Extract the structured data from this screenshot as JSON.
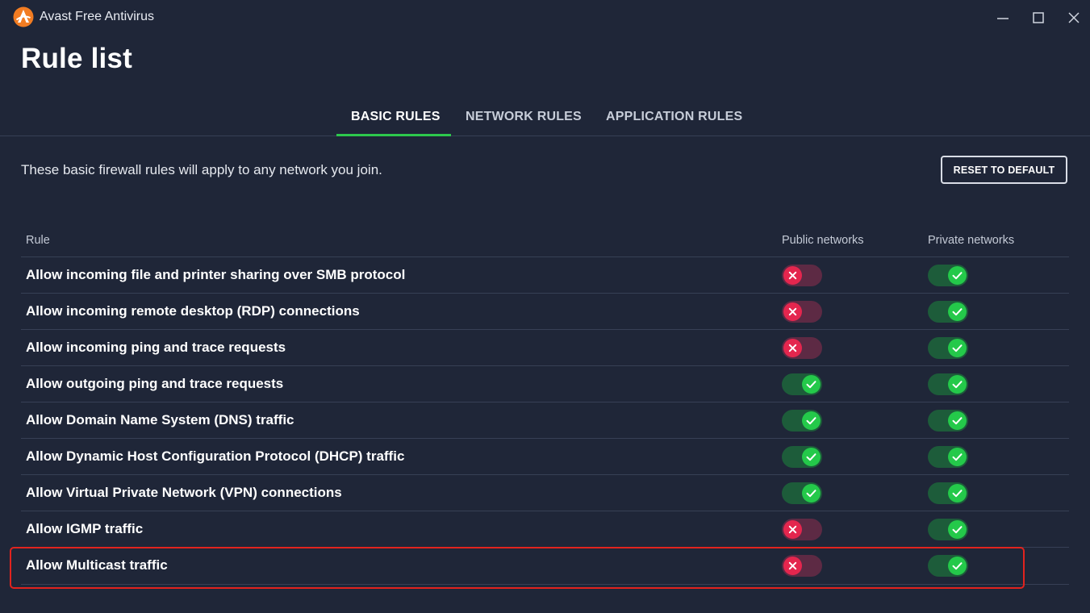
{
  "app": {
    "name": "Avast Free Antivirus"
  },
  "page": {
    "title": "Rule list"
  },
  "tabs": [
    {
      "label": "BASIC RULES",
      "active": true
    },
    {
      "label": "NETWORK RULES",
      "active": false
    },
    {
      "label": "APPLICATION RULES",
      "active": false
    }
  ],
  "intro": "These basic firewall rules will apply to any network you join.",
  "reset_button": "RESET TO DEFAULT",
  "table": {
    "headers": {
      "rule": "Rule",
      "public": "Public networks",
      "private": "Private networks"
    },
    "rows": [
      {
        "label": "Allow incoming file and printer sharing over SMB protocol",
        "public": false,
        "private": true
      },
      {
        "label": "Allow incoming remote desktop (RDP) connections",
        "public": false,
        "private": true
      },
      {
        "label": "Allow incoming ping and trace requests",
        "public": false,
        "private": true
      },
      {
        "label": "Allow outgoing ping and trace requests",
        "public": true,
        "private": true
      },
      {
        "label": "Allow Domain Name System (DNS) traffic",
        "public": true,
        "private": true
      },
      {
        "label": "Allow Dynamic Host Configuration Protocol (DHCP) traffic",
        "public": true,
        "private": true
      },
      {
        "label": "Allow Virtual Private Network (VPN) connections",
        "public": true,
        "private": true
      },
      {
        "label": "Allow IGMP traffic",
        "public": false,
        "private": true
      },
      {
        "label": "Allow Multicast traffic",
        "public": false,
        "private": true
      }
    ]
  },
  "colors": {
    "accent": "#2dc84d",
    "off": "#e4264e",
    "background": "#1f2638",
    "highlight": "#e1231e"
  },
  "icons": {
    "logo": "avast-logo-icon",
    "toggle_on": "check-icon",
    "toggle_off": "x-icon"
  }
}
